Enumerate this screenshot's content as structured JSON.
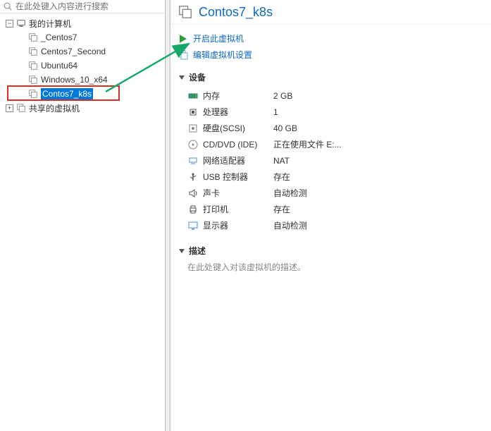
{
  "search": {
    "placeholder": "在此处键入内容进行搜索"
  },
  "tree": {
    "root": {
      "label": "我的计算机",
      "expanded": true
    },
    "children": [
      {
        "label": "_Centos7"
      },
      {
        "label": "Centos7_Second"
      },
      {
        "label": "Ubuntu64"
      },
      {
        "label": "Windows_10_x64"
      },
      {
        "label": "Contos7_k8s",
        "selected": true
      }
    ],
    "shared": {
      "label": "共享的虚拟机",
      "expanded": false
    }
  },
  "tab": {
    "title": "Contos7_k8s"
  },
  "actions": {
    "power_on": "开启此虚拟机",
    "edit_settings": "编辑虚拟机设置"
  },
  "sections": {
    "devices": {
      "title": "设备"
    },
    "description": {
      "title": "描述",
      "placeholder": "在此处键入对该虚拟机的描述。"
    }
  },
  "devices": [
    {
      "name": "内存",
      "value": "2 GB",
      "icon": "memory"
    },
    {
      "name": "处理器",
      "value": "1",
      "icon": "cpu"
    },
    {
      "name": "硬盘(SCSI)",
      "value": "40 GB",
      "icon": "disk"
    },
    {
      "name": "CD/DVD (IDE)",
      "value": "正在使用文件 E:...",
      "icon": "cd"
    },
    {
      "name": "网络适配器",
      "value": "NAT",
      "icon": "network"
    },
    {
      "name": "USB 控制器",
      "value": "存在",
      "icon": "usb"
    },
    {
      "name": "声卡",
      "value": "自动检测",
      "icon": "sound"
    },
    {
      "name": "打印机",
      "value": "存在",
      "icon": "printer"
    },
    {
      "name": "显示器",
      "value": "自动检测",
      "icon": "display"
    }
  ]
}
